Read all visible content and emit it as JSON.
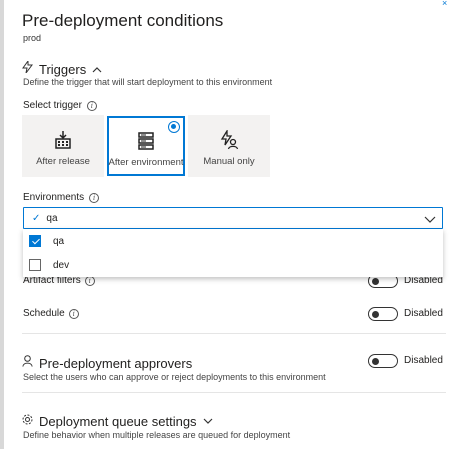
{
  "header": {
    "title": "Pre-deployment conditions",
    "subtitle": "prod"
  },
  "triggers": {
    "heading": "Triggers",
    "description": "Define the trigger that will start deployment to this environment",
    "select_label": "Select trigger",
    "options": [
      {
        "label": "After release",
        "icon": "release-icon",
        "selected": false
      },
      {
        "label": "After environment",
        "icon": "server-icon",
        "selected": true
      },
      {
        "label": "Manual only",
        "icon": "manual-icon",
        "selected": false
      }
    ]
  },
  "environments": {
    "label": "Environments",
    "selected_value": "qa",
    "options": [
      {
        "label": "qa",
        "checked": true
      },
      {
        "label": "dev",
        "checked": false
      }
    ]
  },
  "artifact_filters": {
    "label": "Artifact filters",
    "state": "Disabled"
  },
  "schedule": {
    "label": "Schedule",
    "state": "Disabled"
  },
  "approvers": {
    "heading": "Pre-deployment approvers",
    "description": "Select the users who can approve or reject deployments to this environment",
    "state": "Disabled"
  },
  "queue": {
    "heading": "Deployment queue settings",
    "description": "Define behavior when multiple releases are queued for deployment"
  },
  "colors": {
    "accent": "#0078d4",
    "tile_bg": "#f3f2f1"
  }
}
